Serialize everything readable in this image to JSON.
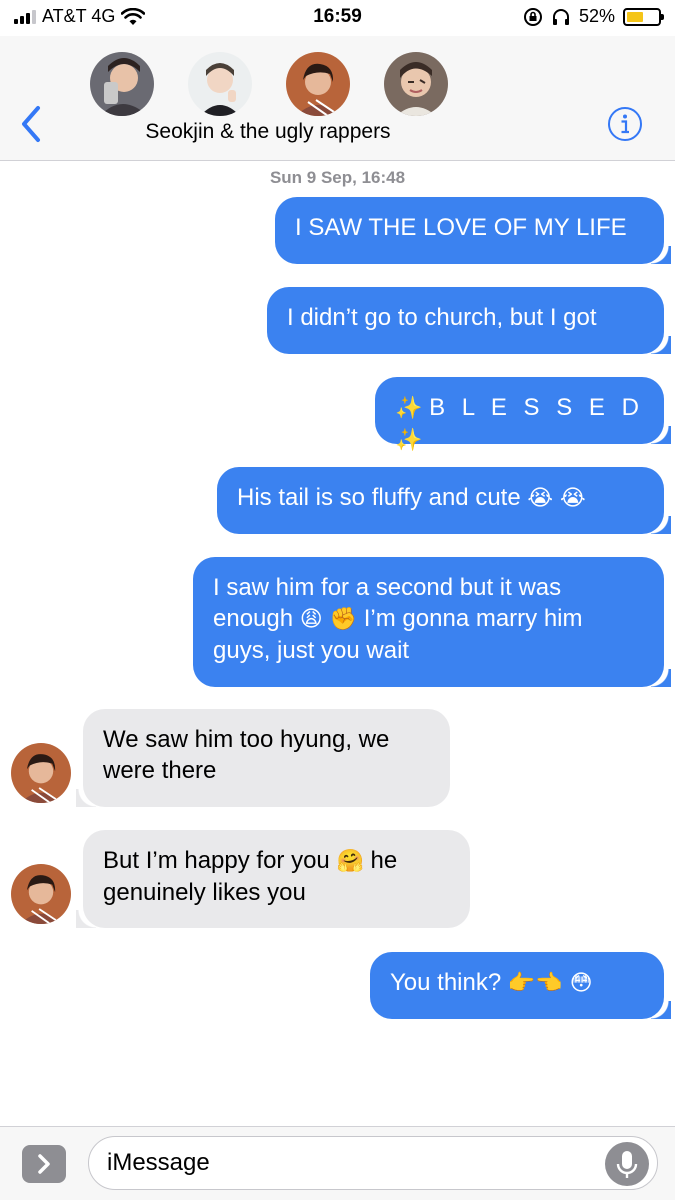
{
  "status_bar": {
    "carrier": "AT&T 4G",
    "time": "16:59",
    "battery_percent": "52%",
    "battery_level": 0.52,
    "battery_color": "#f5c518"
  },
  "header": {
    "group_name": "Seokjin & the ugly rappers",
    "avatar_count": 4,
    "back_icon": "chevron-left-icon",
    "info_icon": "info-icon",
    "accent_color": "#3478f6"
  },
  "conversation": {
    "timestamp": "Sun 9 Sep, 16:48",
    "sent_color": "#3b82f0",
    "received_color": "#e9e9eb",
    "messages": [
      {
        "direction": "sent",
        "text": "I SAW THE LOVE OF MY LIFE"
      },
      {
        "direction": "sent",
        "text": "I didn’t go to church, but I got"
      },
      {
        "direction": "sent",
        "emoji_left": "✨",
        "text": "B L E S S E D",
        "emoji_right": "✨"
      },
      {
        "direction": "sent",
        "text": "His tail is so fluffy and cute",
        "emoji": "😭 😭"
      },
      {
        "direction": "sent",
        "line1": "I saw him for a second but it was",
        "line2_start": "enough",
        "line2_emoji": "😩 ✊",
        "line2_end": "I’m gonna marry him",
        "line3": "guys, just you wait"
      },
      {
        "direction": "received",
        "line1": "We saw him too hyung, we",
        "line2": "were there"
      },
      {
        "direction": "received",
        "line1_start": "But I’m happy for you",
        "line1_emoji": "🤗",
        "line1_end": "he",
        "line2": "genuinely likes you"
      },
      {
        "direction": "sent",
        "text": "You think?",
        "emoji": "👉👈 😳"
      }
    ]
  },
  "input_bar": {
    "placeholder": "iMessage",
    "apps_icon": "chevron-right-icon",
    "mic_icon": "microphone-icon"
  }
}
